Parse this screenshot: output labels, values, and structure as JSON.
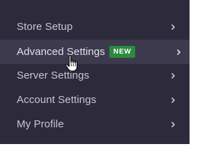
{
  "menu": {
    "items": [
      {
        "label": "Store Setup"
      },
      {
        "label": "Advanced Settings",
        "badge": "NEW"
      },
      {
        "label": "Server Settings"
      },
      {
        "label": "Account Settings"
      },
      {
        "label": "My Profile"
      }
    ]
  },
  "colors": {
    "menu_background": "#2d2a3b",
    "active_background": "#3e3a4d",
    "badge_background": "#2a8c3e",
    "text": "#c9c7d3"
  },
  "icons": {
    "chevron": "chevron-right-icon",
    "cursor": "hand-pointer-icon"
  }
}
